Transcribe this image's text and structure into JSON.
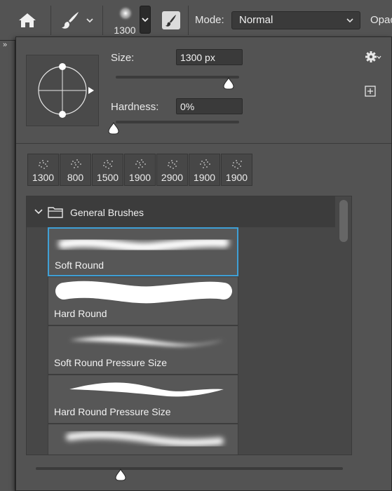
{
  "toolbar": {
    "brush_size": "1300",
    "mode_label": "Mode:",
    "mode_value": "Normal",
    "opacity_label": "Opac"
  },
  "brush_panel": {
    "size_label": "Size:",
    "size_value": "1300 px",
    "hardness_label": "Hardness:",
    "hardness_value": "0%",
    "recent_brushes": [
      "1300",
      "800",
      "1500",
      "1900",
      "2900",
      "1900",
      "1900"
    ],
    "group_name": "General Brushes",
    "brushes": [
      {
        "name": "Soft Round",
        "selected": true
      },
      {
        "name": "Hard Round",
        "selected": false
      },
      {
        "name": "Soft Round Pressure Size",
        "selected": false
      },
      {
        "name": "Hard Round Pressure Size",
        "selected": false
      },
      {
        "name": "",
        "selected": false
      }
    ]
  },
  "colors": {
    "selection_accent": "#3fa0d6",
    "panel_bg": "#535353",
    "field_bg": "#3a3a3a"
  }
}
